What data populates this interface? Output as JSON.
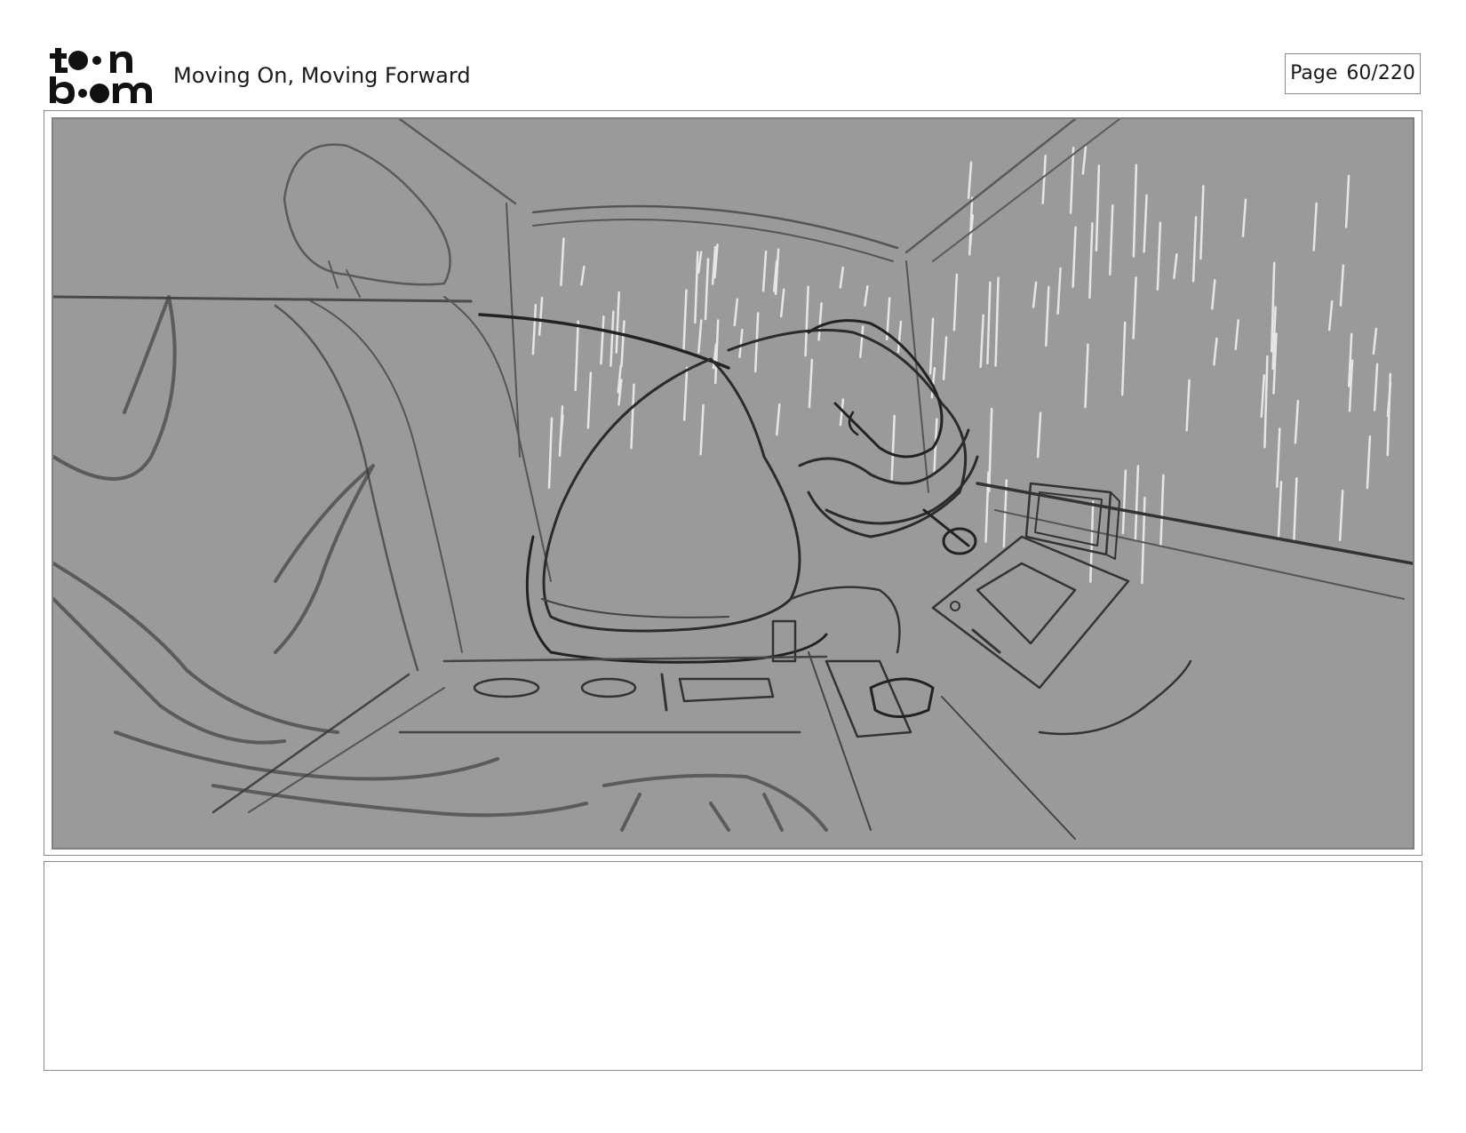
{
  "header": {
    "logo_text": "toonboom",
    "title": "Moving On, Moving Forward"
  },
  "page": {
    "label": "Page",
    "number": "60/220"
  },
  "panel": {
    "background_color": "#9a9a9a",
    "line_color": "#2b2b2b",
    "rain_color": "#e6e6e6"
  },
  "caption": {
    "text": ""
  }
}
